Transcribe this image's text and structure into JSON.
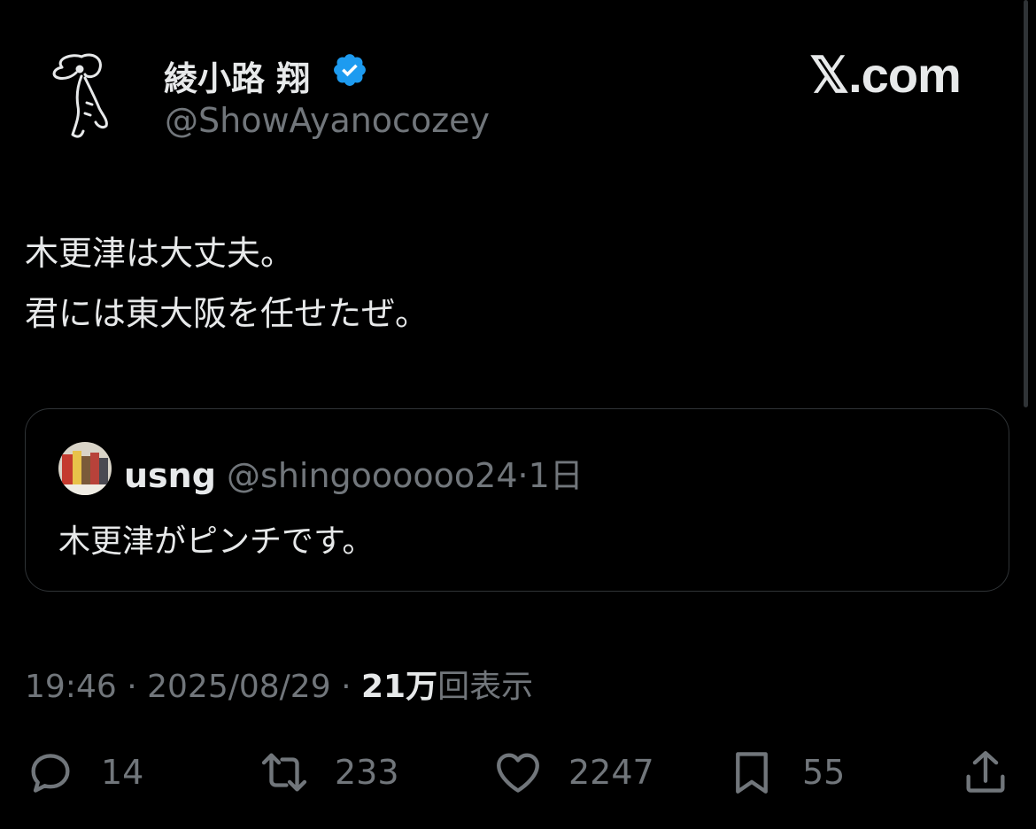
{
  "author": {
    "display_name": "綾小路 翔",
    "handle": "@ShowAyanocozey",
    "verified_icon": "verified-badge-icon"
  },
  "branding": {
    "site": "𝕏.com"
  },
  "tweet": {
    "lines": [
      "木更津は大丈夫。",
      "君には東大阪を任せたぜ。"
    ]
  },
  "quote": {
    "name": "usng",
    "handle": "@shingoooooo24",
    "separator": "·",
    "time": "1日",
    "text": "木更津がピンチです。"
  },
  "meta": {
    "time": "19:46",
    "date": "2025/08/29",
    "separator": "·",
    "views_count": "21万",
    "views_label": "回表示"
  },
  "actions": {
    "replies": "14",
    "reposts": "233",
    "likes": "2247",
    "bookmarks": "55"
  },
  "colors": {
    "background": "#000000",
    "text": "#e7e9ea",
    "secondary": "#71767b",
    "verified": "#1d9bf0",
    "border": "#2f3336"
  }
}
